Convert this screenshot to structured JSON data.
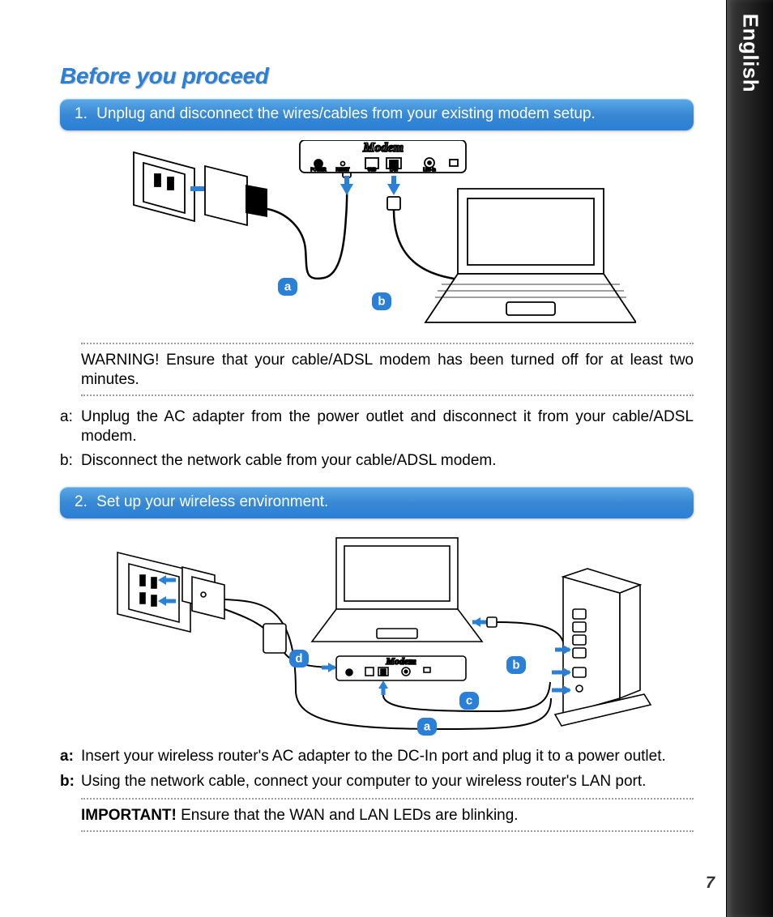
{
  "side_tab": "English",
  "title": "Before you proceed",
  "steps": {
    "s1": {
      "num": "1.",
      "text": "Unplug and disconnect the wires/cables from your existing modem setup.",
      "warning": "WARNING!  Ensure that your cable/ADSL modem has been turned off for at least two minutes.",
      "items": {
        "a_lbl": "a:",
        "a_txt": "Unplug the AC adapter from the power outlet and disconnect it from your cable/ADSL modem.",
        "b_lbl": "b:",
        "b_txt": "Disconnect the network cable from your cable/ADSL modem."
      },
      "badges": {
        "a": "a",
        "b": "b"
      },
      "modem_label": "Modem",
      "port_labels": {
        "power": "POWER",
        "reset": "RESET",
        "usb": "USB",
        "lan": "LAN",
        "line": "Line-In"
      }
    },
    "s2": {
      "num": "2.",
      "text": "Set up your wireless environment.",
      "items": {
        "a_lbl": "a:",
        "a_txt": "Insert your wireless router's AC adapter to the DC-In port and plug it to a power outlet.",
        "b_lbl": "b:",
        "b_txt": "Using the network cable, connect your computer to your wireless router's LAN port."
      },
      "badges": {
        "a": "a",
        "b": "b",
        "c": "c",
        "d": "d"
      },
      "modem_label": "Modem",
      "important_label": "IMPORTANT!",
      "important_text": "  Ensure that the WAN and LAN LEDs are blinking."
    }
  },
  "page_number": "7"
}
